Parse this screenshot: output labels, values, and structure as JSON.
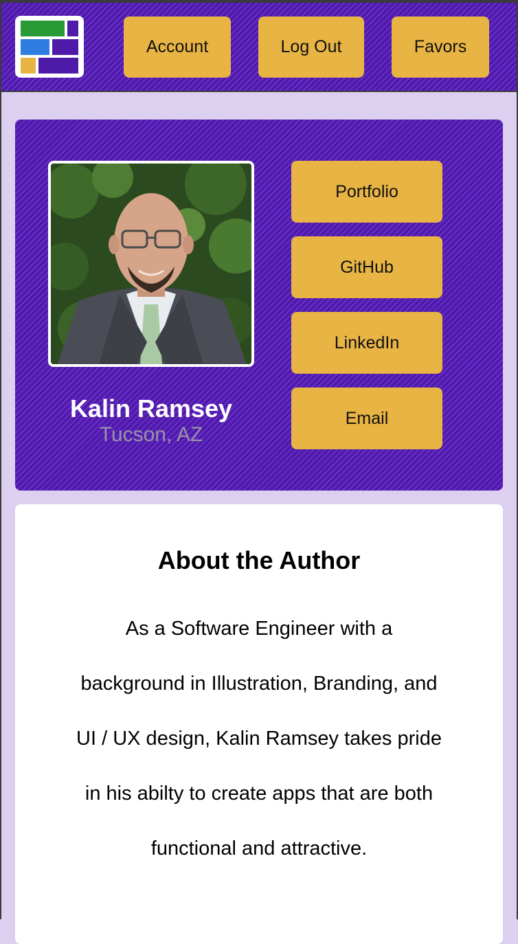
{
  "header": {
    "logo_icon": "app-logo-icon",
    "nav": {
      "account_label": "Account",
      "logout_label": "Log Out",
      "favors_label": "Favors"
    }
  },
  "profile": {
    "name": "Kalin Ramsey",
    "location": "Tucson, AZ",
    "links": {
      "portfolio_label": "Portfolio",
      "github_label": "GitHub",
      "linkedin_label": "LinkedIn",
      "email_label": "Email"
    }
  },
  "about": {
    "title": "About the Author",
    "lines": [
      "As a Software Engineer with a",
      "background in Illustration, Branding, and",
      "UI / UX design, Kalin Ramsey takes pride",
      "in his abilty to create apps that are both",
      "functional and attractive."
    ]
  },
  "colors": {
    "brand_purple": "#4e1aa8",
    "stripe_purple": "#6a2ecc",
    "accent_yellow": "#e8b444",
    "page_background": "#dccff0",
    "logo_green": "#2a9a36",
    "logo_blue": "#2f7de0"
  }
}
